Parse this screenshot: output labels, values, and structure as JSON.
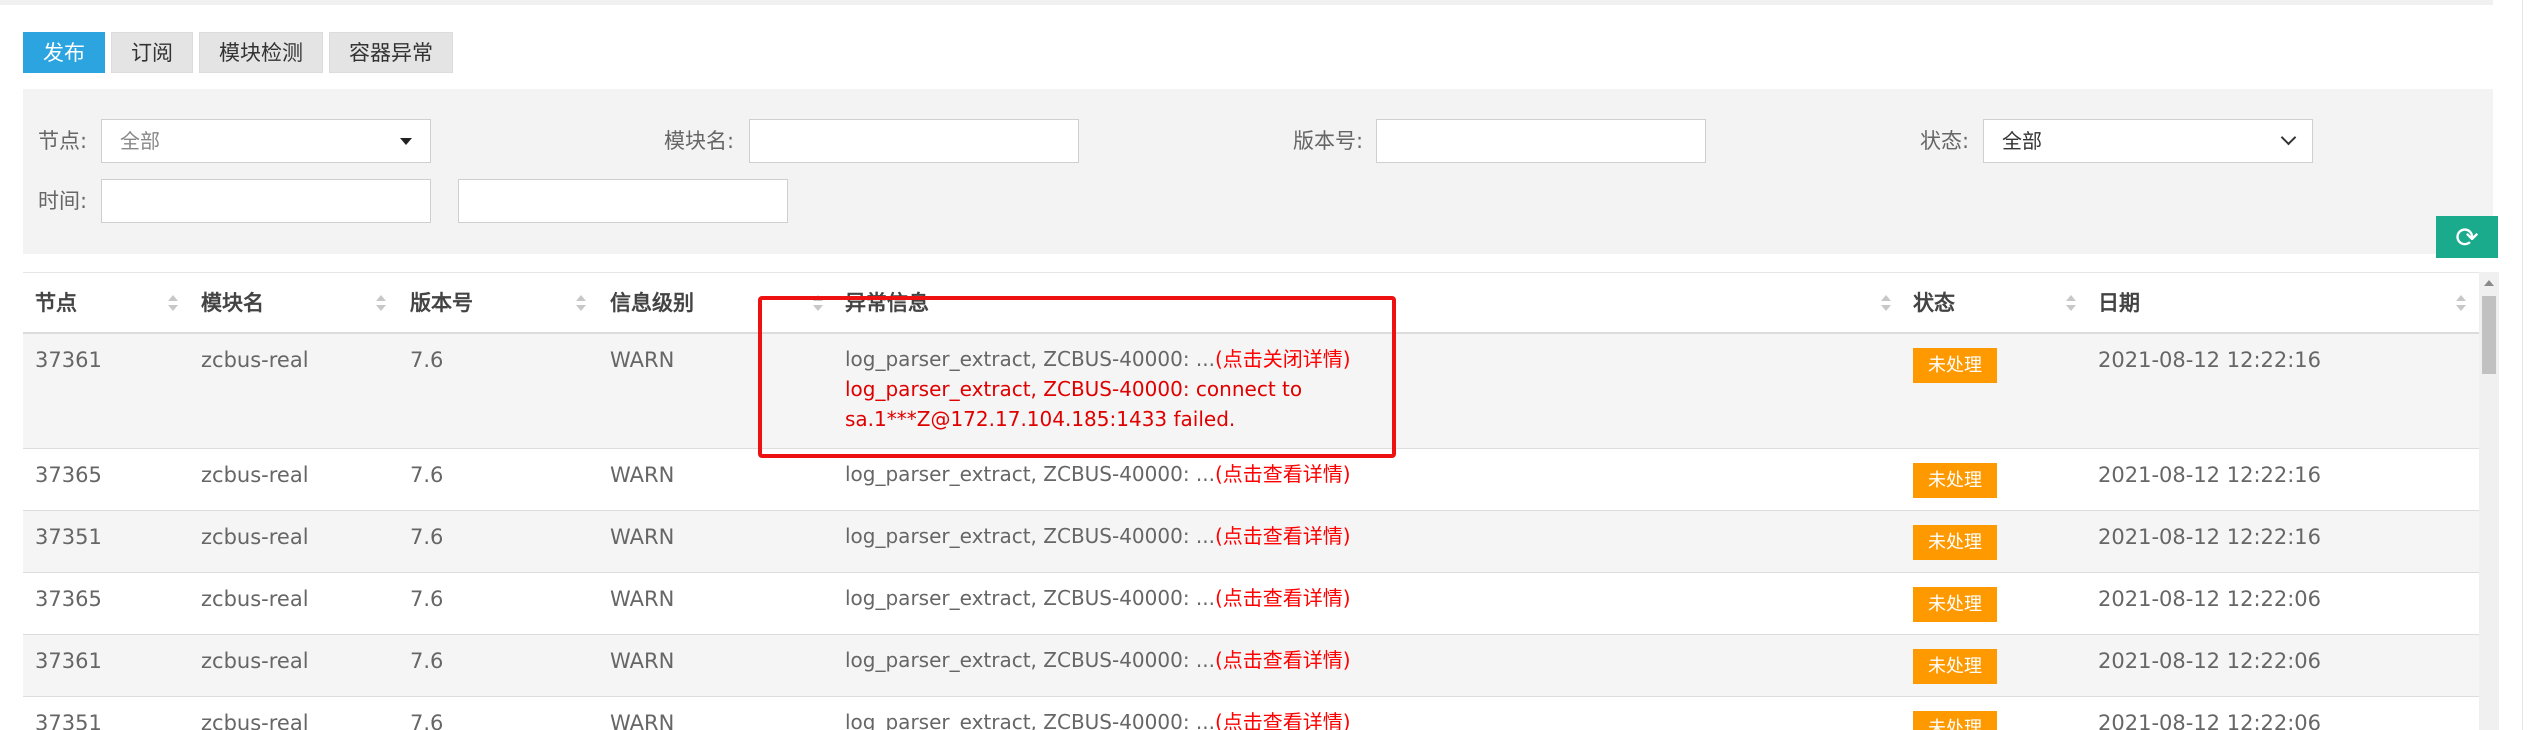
{
  "tabs": [
    {
      "label": "发布",
      "active": true
    },
    {
      "label": "订阅",
      "active": false
    },
    {
      "label": "模块检测",
      "active": false
    },
    {
      "label": "容器异常",
      "active": false
    }
  ],
  "filters": {
    "node_label": "节点:",
    "node_value": "全部",
    "module_label": "模块名:",
    "module_value": "",
    "version_label": "版本号:",
    "version_value": "",
    "status_label": "状态:",
    "status_value": "全部",
    "time_label": "时间:",
    "time_start": "",
    "time_end": ""
  },
  "table": {
    "headers": [
      "节点",
      "模块名",
      "版本号",
      "信息级别",
      "异常信息",
      "状态",
      "日期"
    ],
    "expanded_detail": "log_parser_extract, ZCBUS-40000: connect to sa.1***Z@172.17.104.185:1433 failed.",
    "rows": [
      {
        "node": "37361",
        "module": "zcbus-real",
        "version": "7.6",
        "level": "WARN",
        "message": "log_parser_extract, ZCBUS-40000: ...",
        "link": "(点击关闭详情)",
        "status": "未处理",
        "date": "2021-08-12 12:22:16"
      },
      {
        "node": "37365",
        "module": "zcbus-real",
        "version": "7.6",
        "level": "WARN",
        "message": "log_parser_extract, ZCBUS-40000: ...",
        "link": "(点击查看详情)",
        "status": "未处理",
        "date": "2021-08-12 12:22:16"
      },
      {
        "node": "37351",
        "module": "zcbus-real",
        "version": "7.6",
        "level": "WARN",
        "message": "log_parser_extract, ZCBUS-40000: ...",
        "link": "(点击查看详情)",
        "status": "未处理",
        "date": "2021-08-12 12:22:16"
      },
      {
        "node": "37365",
        "module": "zcbus-real",
        "version": "7.6",
        "level": "WARN",
        "message": "log_parser_extract, ZCBUS-40000: ...",
        "link": "(点击查看详情)",
        "status": "未处理",
        "date": "2021-08-12 12:22:06"
      },
      {
        "node": "37361",
        "module": "zcbus-real",
        "version": "7.6",
        "level": "WARN",
        "message": "log_parser_extract, ZCBUS-40000: ...",
        "link": "(点击查看详情)",
        "status": "未处理",
        "date": "2021-08-12 12:22:06"
      },
      {
        "node": "37351",
        "module": "zcbus-real",
        "version": "7.6",
        "level": "WARN",
        "message": "log_parser_extract, ZCBUS-40000: ...",
        "link": "(点击查看详情)",
        "status": "未处理",
        "date": "2021-08-12 12:22:06"
      }
    ]
  },
  "colors": {
    "accent": "#2ba4e0",
    "status_badge": "#ff9900",
    "link": "#ff0000",
    "refresh": "#1aaa8c",
    "highlight": "#ee1111"
  },
  "icons": {
    "refresh": "refresh-icon",
    "dropdown": "caret-down-icon",
    "sort": "sort-icon"
  }
}
